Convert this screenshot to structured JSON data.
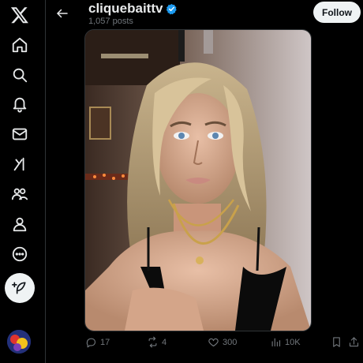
{
  "nav": {
    "items": [
      {
        "icon": "x-logo-icon"
      },
      {
        "icon": "home-icon"
      },
      {
        "icon": "search-icon"
      },
      {
        "icon": "bell-icon"
      },
      {
        "icon": "mail-icon"
      },
      {
        "icon": "grok-icon"
      },
      {
        "icon": "communities-icon"
      },
      {
        "icon": "profile-icon"
      },
      {
        "icon": "more-icon"
      }
    ],
    "post_button_icon": "feather-plus-icon"
  },
  "header": {
    "name": "cliquebaittv",
    "posts_count": "1,057 posts",
    "follow_label": "Follow",
    "verified_color": "#1d9bf0"
  },
  "actions": {
    "replies": "17",
    "reposts": "4",
    "likes": "300",
    "views": "10K"
  },
  "colors": {
    "background": "#000000",
    "text_primary": "#e7e9ea",
    "text_secondary": "#71767b",
    "accent": "#1d9bf0"
  }
}
